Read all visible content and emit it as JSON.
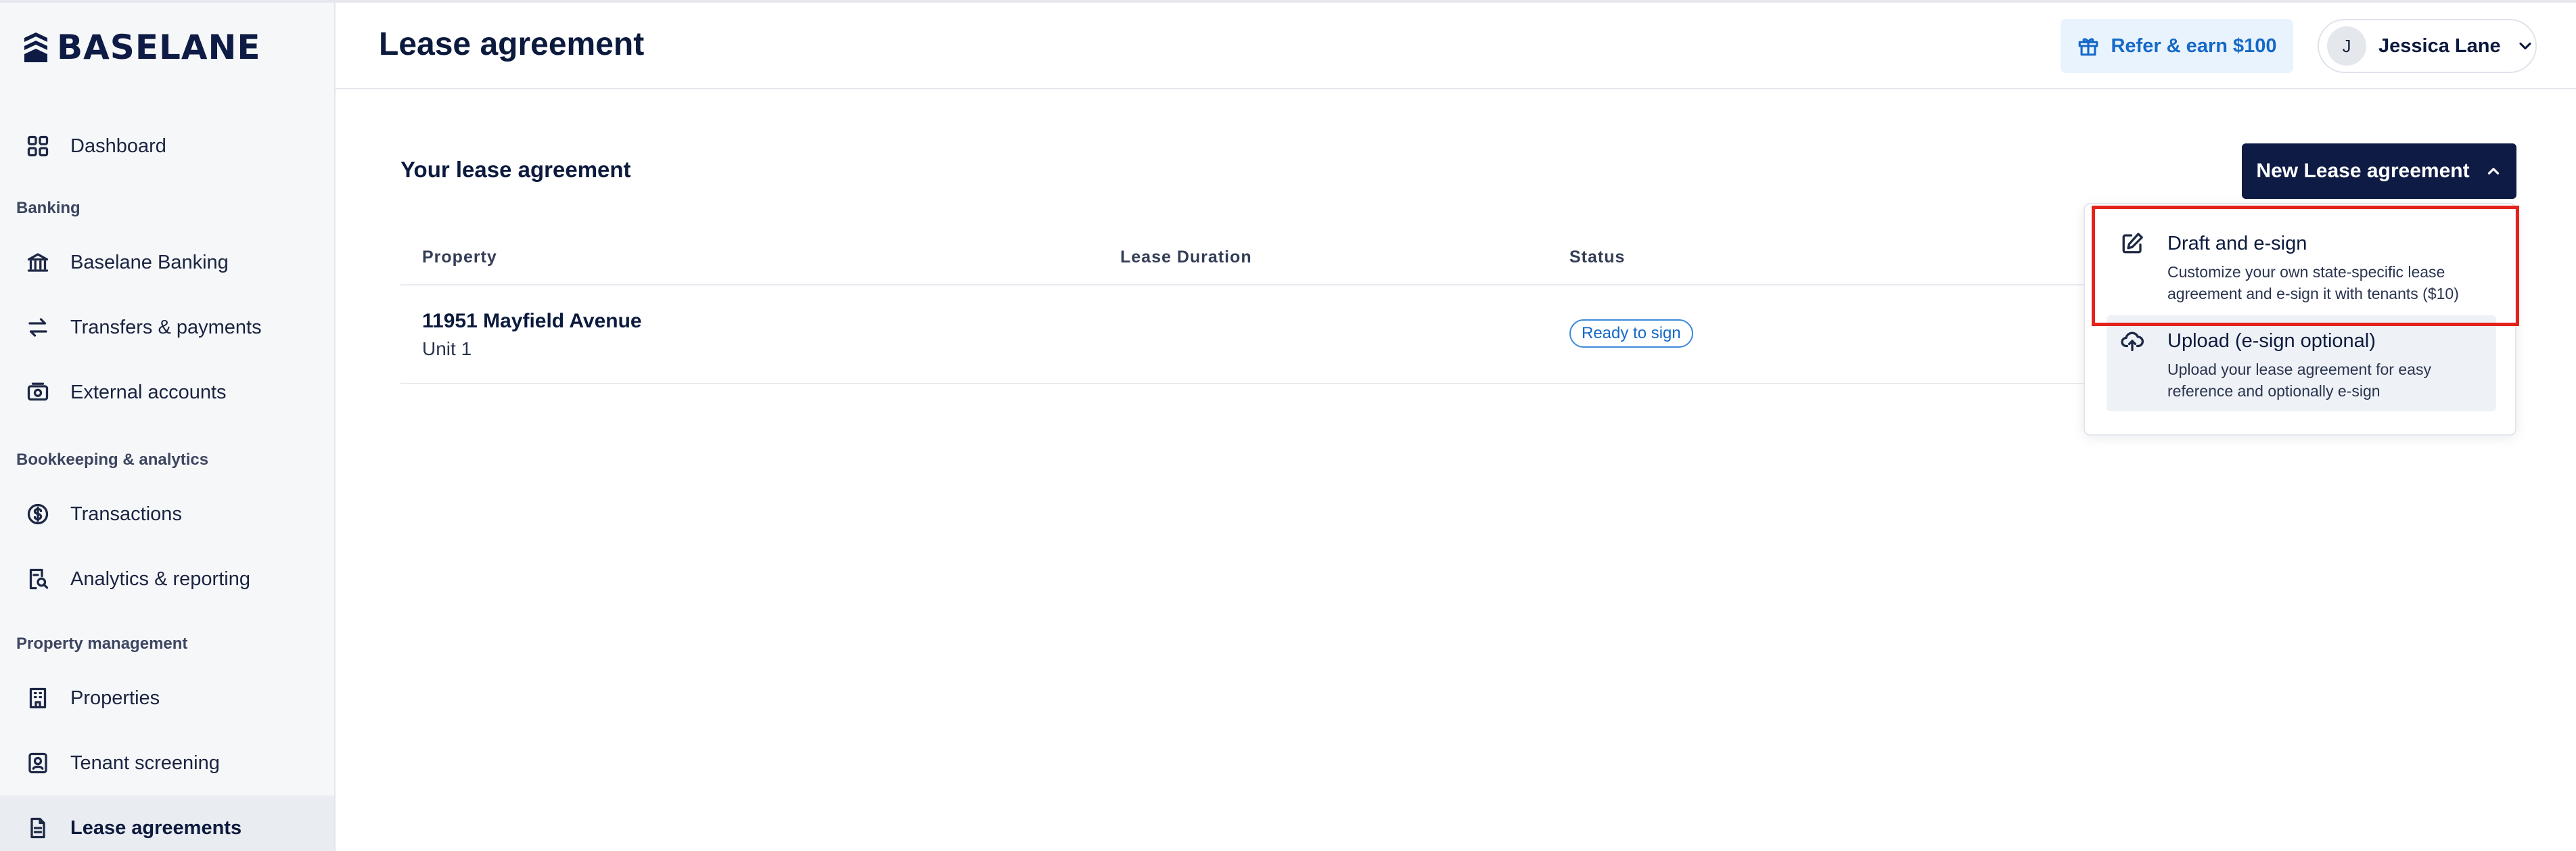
{
  "brand": {
    "name": "BASELANE"
  },
  "sidebar": {
    "items": [
      {
        "label": "Dashboard",
        "icon": "grid-icon"
      },
      {
        "label": "Baselane Banking",
        "icon": "bank-icon"
      },
      {
        "label": "Transfers & payments",
        "icon": "transfer-arrows-icon"
      },
      {
        "label": "External accounts",
        "icon": "cash-icon"
      },
      {
        "label": "Transactions",
        "icon": "dollar-circle-icon"
      },
      {
        "label": "Analytics & reporting",
        "icon": "report-search-icon"
      },
      {
        "label": "Properties",
        "icon": "building-icon"
      },
      {
        "label": "Tenant screening",
        "icon": "user-badge-icon"
      },
      {
        "label": "Lease agreements",
        "icon": "document-icon",
        "active": true
      }
    ],
    "sections": {
      "banking": "Banking",
      "bookkeeping": "Bookkeeping & analytics",
      "property": "Property management"
    }
  },
  "header": {
    "title": "Lease agreement",
    "refer_label": "Refer & earn $100",
    "user": {
      "initial": "J",
      "name": "Jessica Lane"
    }
  },
  "main": {
    "section_title": "Your lease agreement",
    "new_button_label": "New Lease agreement",
    "table": {
      "columns": [
        "Property",
        "Lease Duration",
        "Status"
      ],
      "rows": [
        {
          "property": "11951 Mayfield Avenue",
          "unit": "Unit 1",
          "duration": "",
          "status": "Ready to sign"
        }
      ]
    },
    "dropdown": {
      "items": [
        {
          "title": "Draft and e-sign",
          "description": "Customize your own state-specific lease agreement and e-sign it with tenants ($10)",
          "icon": "edit-icon"
        },
        {
          "title": "Upload (e-sign optional)",
          "description": "Upload your lease agreement for easy reference and optionally e-sign",
          "icon": "cloud-upload-icon"
        }
      ]
    }
  },
  "colors": {
    "primary": "#0e1c45",
    "accent": "#1569c7",
    "highlight": "#e3231b",
    "sidebar_bg": "#f6f7f9"
  }
}
